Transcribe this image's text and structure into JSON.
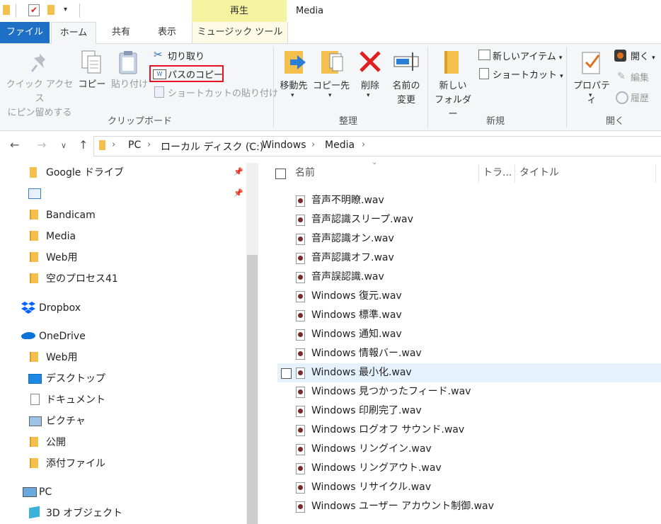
{
  "window": {
    "title": "Media",
    "context_tab_header": "再生"
  },
  "tabs": {
    "file": "ファイル",
    "home": "ホーム",
    "share": "共有",
    "view": "表示",
    "music_tools": "ミュージック ツール"
  },
  "ribbon": {
    "clipboard": {
      "pin_quick_access_line1": "クイック アクセス",
      "pin_quick_access_line2": "にピン留めする",
      "copy": "コピー",
      "paste": "貼り付け",
      "cut": "切り取り",
      "copy_path": "パスのコピー",
      "paste_shortcut": "ショートカットの貼り付け",
      "group": "クリップボード"
    },
    "organize": {
      "move_to": "移動先",
      "copy_to": "コピー先",
      "delete": "削除",
      "rename_line1": "名前の",
      "rename_line2": "変更",
      "group": "整理"
    },
    "new": {
      "new_folder_line1": "新しい",
      "new_folder_line2": "フォルダー",
      "new_item": "新しいアイテム",
      "easy_access": "ショートカット",
      "group": "新規"
    },
    "open": {
      "properties": "プロパティ",
      "open": "開く",
      "edit": "編集",
      "history": "履歴",
      "group": "開く"
    },
    "highlight_color": "#e81123"
  },
  "address": {
    "crumbs": [
      "PC",
      "ローカル ディスク (C:)",
      "Windows",
      "Media"
    ]
  },
  "nav": {
    "quick": [
      "Google ドライブ",
      "",
      "Bandicam",
      "Media",
      "Web用",
      "空のプロセス41"
    ],
    "dropbox": "Dropbox",
    "onedrive": "OneDrive",
    "onedrive_items": [
      "Web用",
      "デスクトップ",
      "ドキュメント",
      "ピクチャ",
      "公開",
      "添付ファイル"
    ],
    "pc": "PC",
    "pc_items": [
      "3D オブジェクト"
    ]
  },
  "list": {
    "columns": {
      "name": "名前",
      "track": "トラ...",
      "title": "タイトル"
    },
    "files": [
      "音声不明瞭.wav",
      "音声認識スリープ.wav",
      "音声認識オン.wav",
      "音声認識オフ.wav",
      "音声誤認識.wav",
      "Windows 復元.wav",
      "Windows 標準.wav",
      "Windows 通知.wav",
      "Windows 情報バー.wav",
      "Windows 最小化.wav",
      "Windows 見つかったフィード.wav",
      "Windows 印刷完了.wav",
      "Windows ログオフ サウンド.wav",
      "Windows リングイン.wav",
      "Windows リングアウト.wav",
      "Windows リサイクル.wav",
      "Windows ユーザー アカウント制御.wav"
    ],
    "selected_index": 9
  }
}
